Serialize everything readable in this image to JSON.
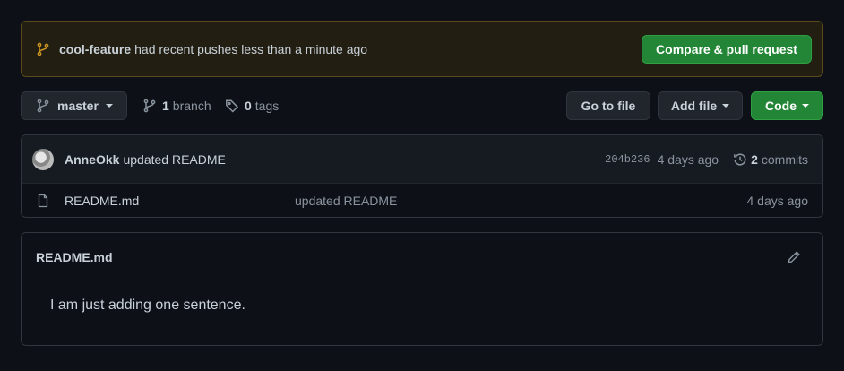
{
  "banner": {
    "branch_name": "cool-feature",
    "text": "had recent pushes less than a minute ago",
    "compare_button": "Compare & pull request",
    "icon": "git-branch-icon"
  },
  "toolbar": {
    "branch_select": "master",
    "branches_count": "1",
    "branches_label": "branch",
    "tags_count": "0",
    "tags_label": "tags",
    "go_to_file": "Go to file",
    "add_file": "Add file",
    "code": "Code"
  },
  "commit": {
    "author": "AnneOkk",
    "message": "updated README",
    "sha": "204b236",
    "age": "4 days ago",
    "commits_count": "2",
    "commits_label": "commits"
  },
  "files": [
    {
      "name": "README.md",
      "commit_message": "updated README",
      "age": "4 days ago",
      "icon": "file-icon"
    }
  ],
  "readme": {
    "title": "README.md",
    "content": "I am just adding one sentence.",
    "edit_icon": "pencil-icon"
  },
  "colors": {
    "background": "#0d1117",
    "banner_bg": "#221e12",
    "banner_border": "#5c4a1c",
    "accent_green": "#238636",
    "branch_icon": "#d29922"
  }
}
